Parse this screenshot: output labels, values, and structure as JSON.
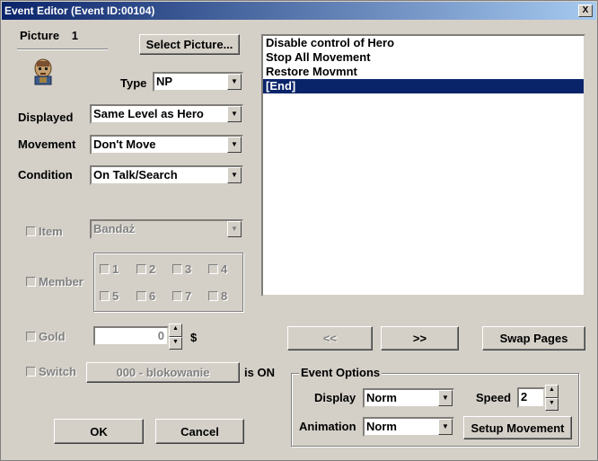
{
  "window": {
    "title": "Event Editor (Event ID:00104)",
    "close_glyph": "X"
  },
  "picture": {
    "label": "Picture",
    "number": "1",
    "select_button": "Select Picture..."
  },
  "type": {
    "label": "Type",
    "value": "NP"
  },
  "displayed": {
    "label": "Displayed",
    "value": "Same Level as Hero"
  },
  "movement": {
    "label": "Movement",
    "value": "Don't Move"
  },
  "condition": {
    "label": "Condition",
    "value": "On Talk/Search"
  },
  "item": {
    "label": "Item",
    "value": "Bandaż"
  },
  "member": {
    "label": "Member",
    "slots": [
      "1",
      "2",
      "3",
      "4",
      "5",
      "6",
      "7",
      "8"
    ]
  },
  "gold": {
    "label": "Gold",
    "value": "0",
    "unit": "$"
  },
  "switch": {
    "label": "Switch",
    "value": "000 - blokowanie",
    "suffix": "is ON"
  },
  "commands": [
    "Disable control of Hero",
    "Stop All Movement",
    "Restore Movmnt",
    "[End]"
  ],
  "selected_command_index": 3,
  "nav": {
    "prev": "<<",
    "next": ">>",
    "swap": "Swap Pages"
  },
  "event_options": {
    "title": "Event Options",
    "display_label": "Display",
    "display_value": "Norm",
    "animation_label": "Animation",
    "animation_value": "Norm",
    "speed_label": "Speed",
    "speed_value": "2",
    "setup_movement": "Setup Movement"
  },
  "footer": {
    "ok": "OK",
    "cancel": "Cancel"
  },
  "colors": {
    "titlebar": "#0a246a",
    "selection": "#0a246a",
    "face": "#d4d0c8"
  }
}
